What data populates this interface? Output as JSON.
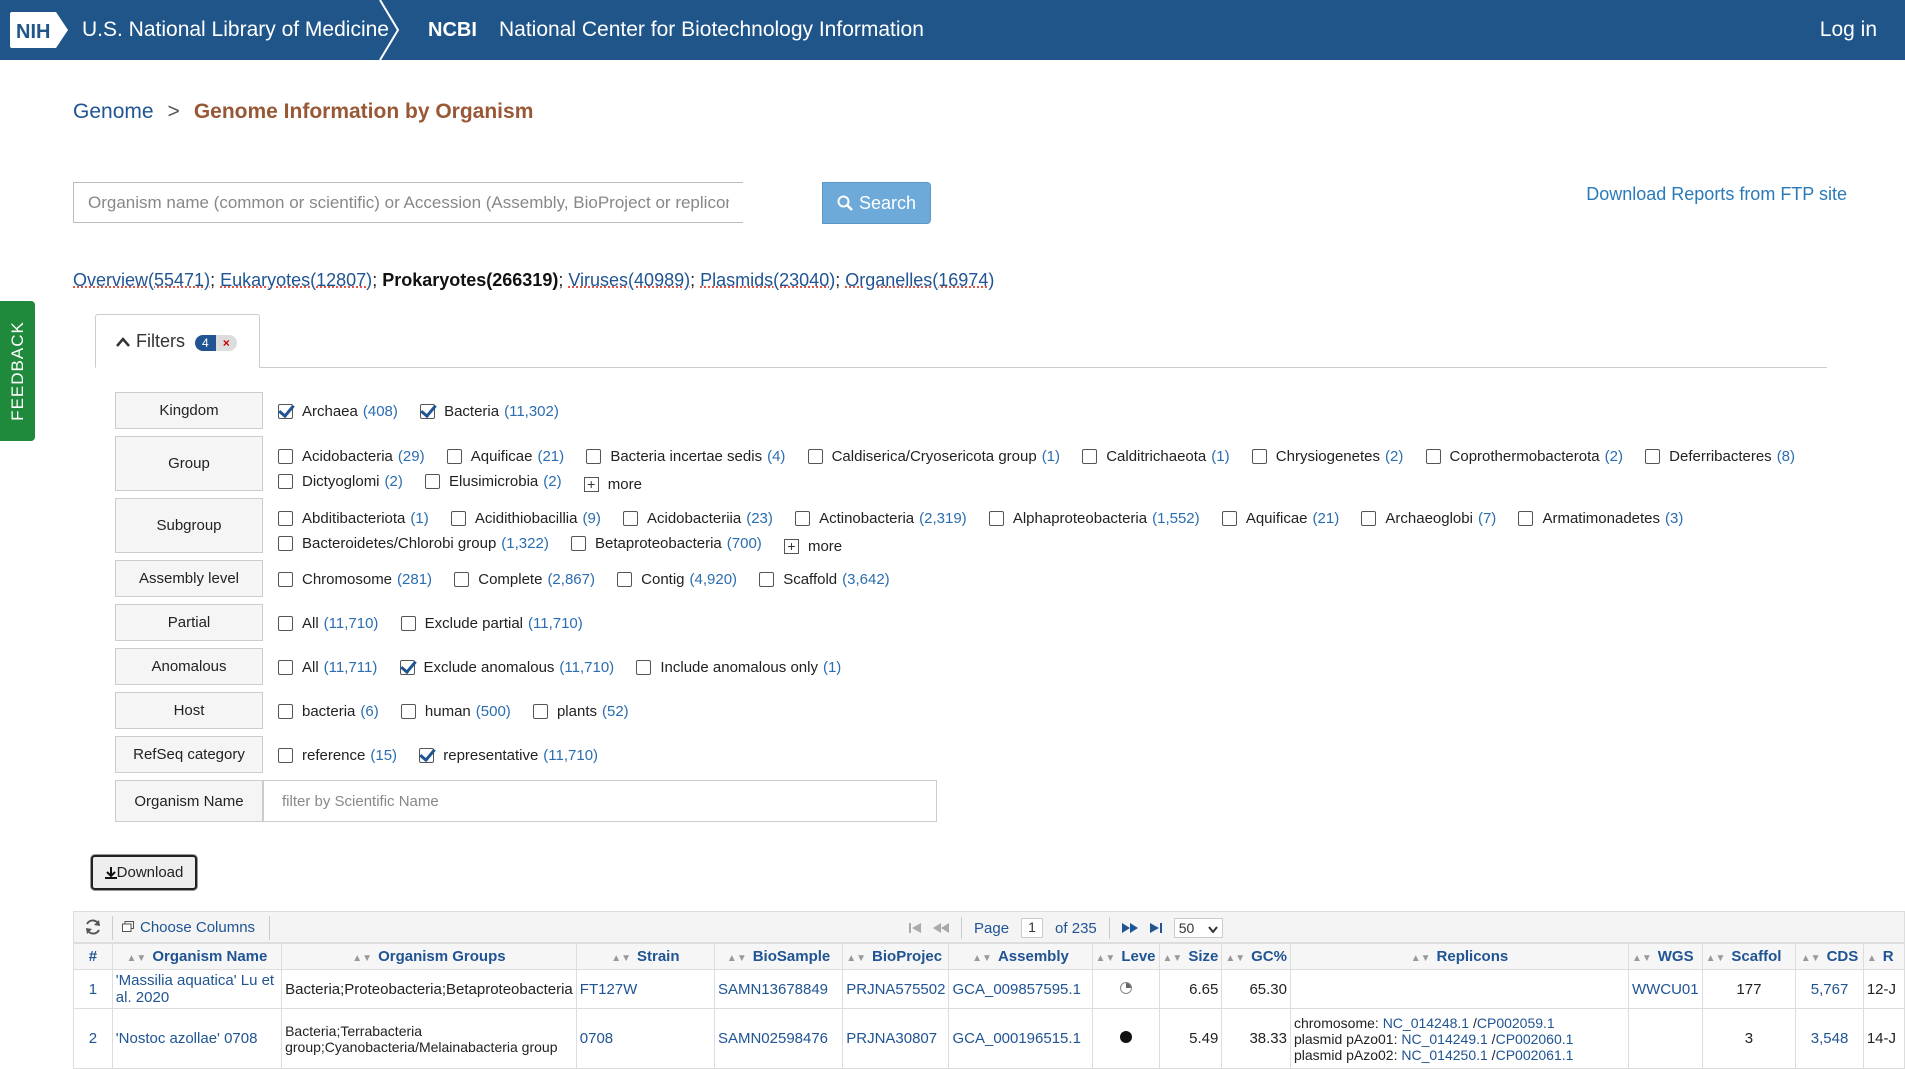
{
  "header": {
    "nlm_title": "U.S. National Library of Medicine",
    "ncbi_short": "NCBI",
    "ncbi_full": "National Center for Biotechnology Information",
    "login": "Log in",
    "nih_logo_text": "NIH"
  },
  "feedback": "FEEDBACK",
  "breadcrumb": {
    "root": "Genome",
    "separator": ">",
    "current": "Genome Information by Organism"
  },
  "search": {
    "placeholder": "Organism name (common or scientific) or Accession (Assembly, BioProject or replicon) ...",
    "button": "Search"
  },
  "ftp_link": "Download Reports from FTP site",
  "categories": [
    {
      "label": "Overview(55471)",
      "sep": ";"
    },
    {
      "label": "Eukaryotes(12807)",
      "sep": ";"
    },
    {
      "label": "Prokaryotes(266319)",
      "sep": ";"
    },
    {
      "label": "Viruses(40989)",
      "sep": ";"
    },
    {
      "label": "Plasmids(23040)",
      "sep": ";"
    },
    {
      "label": "Organelles(16974)",
      "sep": ""
    }
  ],
  "filters": {
    "tab_label": "Filters",
    "count": "4",
    "clear": "×",
    "more_label": "more",
    "kingdom": {
      "label": "Kingdom",
      "options": [
        {
          "name": "Archaea",
          "count": "(408)",
          "checked": true
        },
        {
          "name": "Bacteria",
          "count": "(11,302)",
          "checked": true
        }
      ]
    },
    "group": {
      "label": "Group",
      "options": [
        {
          "name": "Acidobacteria",
          "count": "(29)"
        },
        {
          "name": "Aquificae",
          "count": "(21)"
        },
        {
          "name": "Bacteria incertae sedis",
          "count": "(4)"
        },
        {
          "name": "Caldiserica/Cryosericota group",
          "count": "(1)"
        },
        {
          "name": "Calditrichaeota",
          "count": "(1)"
        },
        {
          "name": "Chrysiogenetes",
          "count": "(2)"
        },
        {
          "name": "Coprothermobacterota",
          "count": "(2)"
        },
        {
          "name": "Deferribacteres",
          "count": "(8)"
        },
        {
          "name": "Dictyoglomi",
          "count": "(2)"
        },
        {
          "name": "Elusimicrobia",
          "count": "(2)"
        }
      ]
    },
    "subgroup": {
      "label": "Subgroup",
      "options": [
        {
          "name": "Abditibacteriota",
          "count": "(1)"
        },
        {
          "name": "Acidithiobacillia",
          "count": "(9)"
        },
        {
          "name": "Acidobacteriia",
          "count": "(23)"
        },
        {
          "name": "Actinobacteria",
          "count": "(2,319)"
        },
        {
          "name": "Alphaproteobacteria",
          "count": "(1,552)"
        },
        {
          "name": "Aquificae",
          "count": "(21)"
        },
        {
          "name": "Archaeoglobi",
          "count": "(7)"
        },
        {
          "name": "Armatimonadetes",
          "count": "(3)"
        },
        {
          "name": "Bacteroidetes/Chlorobi group",
          "count": "(1,322)"
        },
        {
          "name": "Betaproteobacteria",
          "count": "(700)"
        }
      ]
    },
    "assembly_level": {
      "label": "Assembly level",
      "options": [
        {
          "name": "Chromosome",
          "count": "(281)"
        },
        {
          "name": "Complete",
          "count": "(2,867)"
        },
        {
          "name": "Contig",
          "count": "(4,920)"
        },
        {
          "name": "Scaffold",
          "count": "(3,642)"
        }
      ]
    },
    "partial": {
      "label": "Partial",
      "options": [
        {
          "name": "All",
          "count": "(11,710)"
        },
        {
          "name": "Exclude partial",
          "count": "(11,710)"
        }
      ]
    },
    "anomalous": {
      "label": "Anomalous",
      "options": [
        {
          "name": "All",
          "count": "(11,711)"
        },
        {
          "name": "Exclude anomalous",
          "count": "(11,710)",
          "checked": true
        },
        {
          "name": "Include anomalous only",
          "count": "(1)"
        }
      ]
    },
    "host": {
      "label": "Host",
      "options": [
        {
          "name": "bacteria",
          "count": "(6)"
        },
        {
          "name": "human",
          "count": "(500)"
        },
        {
          "name": "plants",
          "count": "(52)"
        }
      ]
    },
    "refseq": {
      "label": "RefSeq category",
      "options": [
        {
          "name": "reference",
          "count": "(15)"
        },
        {
          "name": "representative",
          "count": "(11,710)",
          "checked": true
        }
      ]
    },
    "organism_name": {
      "label": "Organism Name",
      "placeholder": "filter by Scientific Name"
    }
  },
  "download": "Download",
  "toolbar": {
    "choose_columns": "Choose Columns",
    "page_label": "Page",
    "page": "1",
    "of_label": "of 235",
    "page_size": "50"
  },
  "table": {
    "columns": [
      "#",
      "Organism Name",
      "Organism Groups",
      "Strain",
      "BioSample",
      "BioProjec",
      "Assembly",
      "Leve",
      "Size",
      "GC%",
      "Replicons",
      "WGS",
      "Scaffol",
      "CDS",
      "R"
    ],
    "rows": [
      {
        "num": "1",
        "organism": "'Massilia aquatica' Lu et al. 2020",
        "groups": "Bacteria;Proteobacteria;Betaproteobacteria",
        "strain": "FT127W",
        "biosample": "SAMN13678849",
        "bioproject": "PRJNA575502",
        "assembly": "GCA_009857595.1",
        "level": "partial",
        "size": "6.65",
        "gc": "65.30",
        "replicons": [],
        "wgs": "WWCU01",
        "scaffolds": "177",
        "cds": "5,767",
        "release": "12-J"
      },
      {
        "num": "2",
        "organism": "'Nostoc azollae' 0708",
        "groups": "Bacteria;Terrabacteria group;Cyanobacteria/Melainabacteria group",
        "strain": "0708",
        "biosample": "SAMN02598476",
        "bioproject": "PRJNA30807",
        "assembly": "GCA_000196515.1",
        "level": "full",
        "size": "5.49",
        "gc": "38.33",
        "replicons": [
          {
            "prefix": "chromosome:",
            "a": "NC_014248.1",
            "b": "CP002059.1"
          },
          {
            "prefix": "plasmid pAzo01:",
            "a": "NC_014249.1",
            "b": "CP002060.1"
          },
          {
            "prefix": "plasmid pAzo02:",
            "a": "NC_014250.1",
            "b": "CP002061.1"
          }
        ],
        "wgs": "",
        "scaffolds": "3",
        "cds": "3,548",
        "release": "14-J"
      }
    ]
  }
}
